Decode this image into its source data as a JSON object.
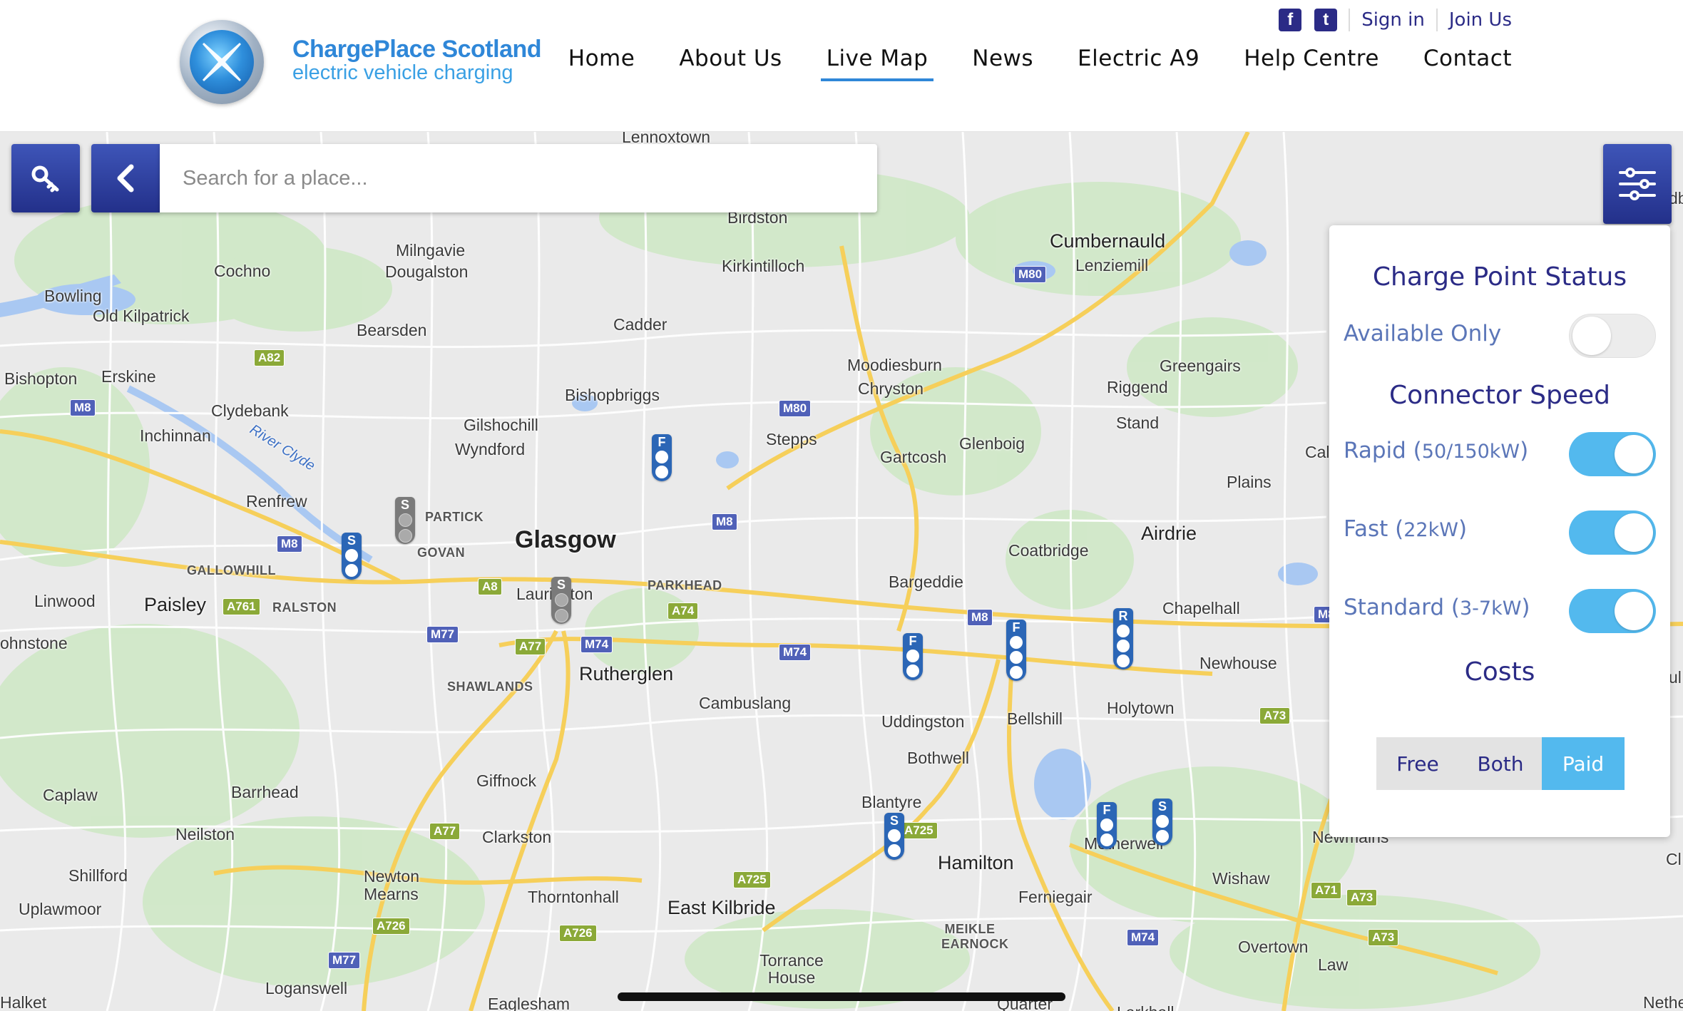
{
  "brand": {
    "title": "ChargePlace Scotland",
    "subtitle": "electric vehicle charging"
  },
  "top_links": {
    "facebook_glyph": "f",
    "twitter_glyph": "t",
    "sign_in": "Sign in",
    "join_us": "Join Us"
  },
  "nav": {
    "items": [
      {
        "label": "Home"
      },
      {
        "label": "About Us"
      },
      {
        "label": "Live Map"
      },
      {
        "label": "News"
      },
      {
        "label": "Electric A9"
      },
      {
        "label": "Help Centre"
      },
      {
        "label": "Contact"
      }
    ],
    "active": "Live Map"
  },
  "search": {
    "placeholder": "Search for a place..."
  },
  "filters": {
    "status_heading": "Charge Point Status",
    "available_only": {
      "label": "Available Only",
      "on": false
    },
    "speed_heading": "Connector Speed",
    "rapid": {
      "label": "Rapid (",
      "unit": "50/150kW",
      "close": ")",
      "on": true
    },
    "fast": {
      "label": "Fast (",
      "unit": "22kW",
      "close": ")",
      "on": true
    },
    "standard": {
      "label": "Standard (",
      "unit": "3-7kW",
      "close": ")",
      "on": true
    },
    "costs_heading": "Costs",
    "costs_options": [
      "Free",
      "Both",
      "Paid"
    ],
    "costs_selected": "Paid"
  },
  "map": {
    "places": [
      {
        "name": "Lennoxtown"
      },
      {
        "name": "Birdston"
      },
      {
        "name": "Cumbernauld"
      },
      {
        "name": "Lenziemill"
      },
      {
        "name": "Milngavie"
      },
      {
        "name": "Dougalston"
      },
      {
        "name": "Kirkintilloch"
      },
      {
        "name": "Cochno"
      },
      {
        "name": "Bowling"
      },
      {
        "name": "Old Kilpatrick"
      },
      {
        "name": "Bearsden"
      },
      {
        "name": "Cadder"
      },
      {
        "name": "Moodiesburn"
      },
      {
        "name": "Chryston"
      },
      {
        "name": "Greengairs"
      },
      {
        "name": "Riggend"
      },
      {
        "name": "Bishopton"
      },
      {
        "name": "Erskine"
      },
      {
        "name": "Clydebank"
      },
      {
        "name": "Bishopbriggs"
      },
      {
        "name": "Inchinnan"
      },
      {
        "name": "Gilshochill"
      },
      {
        "name": "Wyndford"
      },
      {
        "name": "Stepps"
      },
      {
        "name": "Glenboig"
      },
      {
        "name": "Stand"
      },
      {
        "name": "Gartcosh"
      },
      {
        "name": "Calderc"
      },
      {
        "name": "Plains"
      },
      {
        "name": "Renfrew"
      },
      {
        "name": "PARTICK"
      },
      {
        "name": "GOVAN"
      },
      {
        "name": "Glasgow"
      },
      {
        "name": "Airdrie"
      },
      {
        "name": "Coatbridge"
      },
      {
        "name": "GALLOWHILL"
      },
      {
        "name": "Linwood"
      },
      {
        "name": "Paisley"
      },
      {
        "name": "RALSTON"
      },
      {
        "name": "Laurieston"
      },
      {
        "name": "PARKHEAD"
      },
      {
        "name": "Bargeddie"
      },
      {
        "name": "Chapelhall"
      },
      {
        "name": "ohnstone"
      },
      {
        "name": "SHAWLANDS"
      },
      {
        "name": "Rutherglen"
      },
      {
        "name": "Cambuslang"
      },
      {
        "name": "Newhouse"
      },
      {
        "name": "Uddingston"
      },
      {
        "name": "Bellshill"
      },
      {
        "name": "Holytown"
      },
      {
        "name": "Bothwell"
      },
      {
        "name": "Giffnock"
      },
      {
        "name": "Caplaw"
      },
      {
        "name": "Barrhead"
      },
      {
        "name": "Blantyre"
      },
      {
        "name": "Neilston"
      },
      {
        "name": "Clarkston"
      },
      {
        "name": "Motherwell"
      },
      {
        "name": "Newmains"
      },
      {
        "name": "Hamilton"
      },
      {
        "name": "Shillford"
      },
      {
        "name": "Newton Mearns"
      },
      {
        "name": "Wishaw"
      },
      {
        "name": "Thorntonhall"
      },
      {
        "name": "Ferniegair"
      },
      {
        "name": "Uplawmoor"
      },
      {
        "name": "East Kilbride"
      },
      {
        "name": "MEIKLE EARNOCK"
      },
      {
        "name": "Overtown"
      },
      {
        "name": "Torrance House"
      },
      {
        "name": "Law"
      },
      {
        "name": "Loganswell"
      },
      {
        "name": "Halket"
      },
      {
        "name": "Eaglesham"
      },
      {
        "name": "Quarter"
      },
      {
        "name": "Larkhall"
      },
      {
        "name": "Nethe"
      },
      {
        "name": "River Clyde"
      },
      {
        "name": "Cl"
      },
      {
        "name": "ul"
      },
      {
        "name": "db"
      }
    ],
    "roads": [
      "M80",
      "M80",
      "M8",
      "A82",
      "M8",
      "M8",
      "A8",
      "A761",
      "M77",
      "A77",
      "M74",
      "A74",
      "M74",
      "M8",
      "M8",
      "A73",
      "A725",
      "A725",
      "A77",
      "A726",
      "A726",
      "M77",
      "A71",
      "A73",
      "A73",
      "M74"
    ],
    "markers": [
      {
        "letter": "F",
        "dots": 2,
        "color": "blue"
      },
      {
        "letter": "S",
        "dots": 2,
        "color": "grey"
      },
      {
        "letter": "S",
        "dots": 2,
        "color": "blue"
      },
      {
        "letter": "S",
        "dots": 2,
        "color": "grey"
      },
      {
        "letter": "F",
        "dots": 2,
        "color": "blue"
      },
      {
        "letter": "F",
        "dots": 3,
        "color": "blue"
      },
      {
        "letter": "R",
        "dots": 3,
        "color": "blue"
      },
      {
        "letter": "S",
        "dots": 2,
        "color": "blue"
      },
      {
        "letter": "F",
        "dots": 2,
        "color": "blue"
      },
      {
        "letter": "S",
        "dots": 2,
        "color": "blue"
      }
    ]
  }
}
